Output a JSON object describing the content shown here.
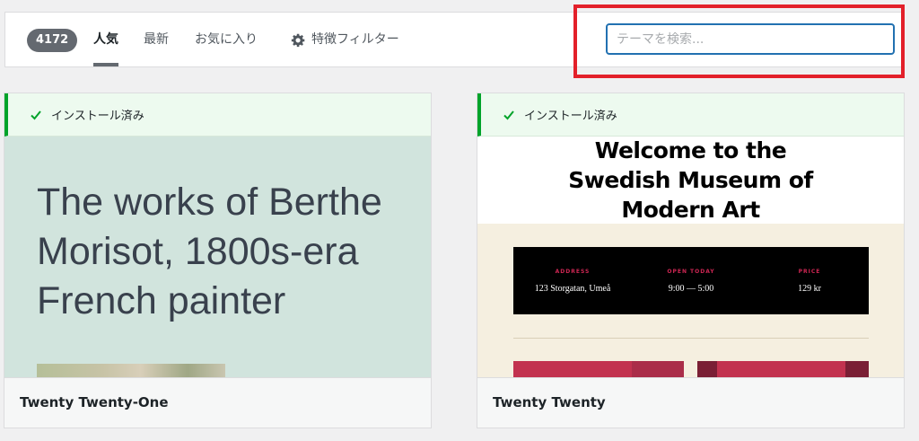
{
  "filter_bar": {
    "count": "4172",
    "links": {
      "popular": "人気",
      "latest": "最新",
      "favorites": "お気に入り"
    },
    "feature_filter": "特徴フィルター"
  },
  "search": {
    "placeholder": "テーマを検索..."
  },
  "colors": {
    "accent": "#2271b1",
    "highlight": "#e3202a",
    "installed": "#00a32a"
  },
  "themes": [
    {
      "name": "Twenty Twenty-One",
      "installed_label": "インストール済み",
      "preview": {
        "headline": "The works of Berthe Morisot, 1800s-era French painter"
      }
    },
    {
      "name": "Twenty Twenty",
      "installed_label": "インストール済み",
      "preview": {
        "headline": "Welcome to the Swedish Museum of Modern Art",
        "info": [
          {
            "label": "ADDRESS",
            "value": "123 Storgatan, Umeå"
          },
          {
            "label": "OPEN TODAY",
            "value": "9:00 — 5:00"
          },
          {
            "label": "PRICE",
            "value": "129 kr"
          }
        ]
      }
    }
  ]
}
